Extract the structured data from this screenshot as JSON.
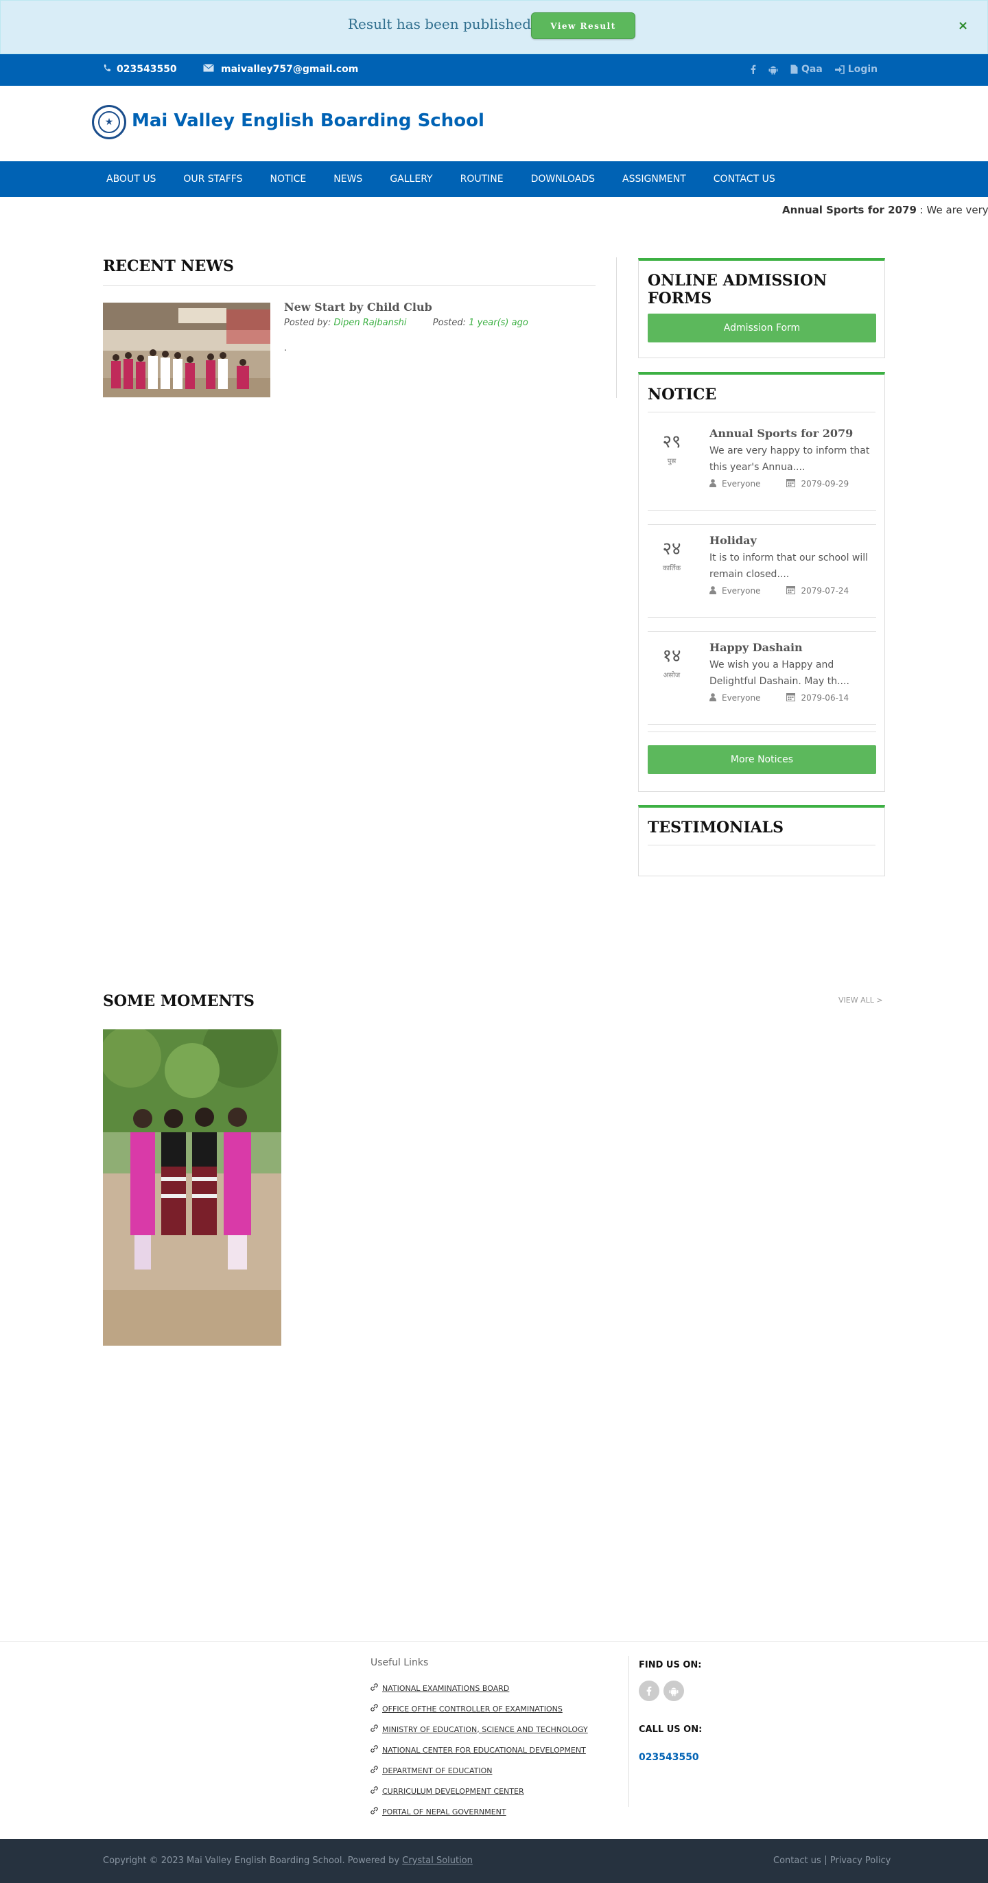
{
  "alert": {
    "text": "Result has been published.",
    "button": "View Result",
    "close": "×"
  },
  "topbar": {
    "phone": "023543550",
    "email": "maivalley757@gmail.com",
    "qaa": "Qaa",
    "login": "Login"
  },
  "header": {
    "site_title": "Mai Valley English Boarding School"
  },
  "nav": [
    "ABOUT US",
    "OUR STAFFS",
    "NOTICE",
    "NEWS",
    "GALLERY",
    "ROUTINE",
    "DOWNLOADS",
    "ASSIGNMENT",
    "CONTACT US"
  ],
  "ticker": {
    "bold": "Annual Sports for 2079",
    "text": " : We are very hap"
  },
  "recent_news": {
    "title": "RECENT NEWS",
    "item": {
      "headline": "New Start by Child Club",
      "posted_by_label": "Posted by: ",
      "author": "Dipen Rajbanshi",
      "posted_label": "Posted: ",
      "when": "1 year(s) ago",
      "excerpt": "."
    }
  },
  "admission": {
    "title": "ONLINE ADMISSION FORMS",
    "button": "Admission Form"
  },
  "notice": {
    "title": "NOTICE",
    "items": [
      {
        "day": "२९",
        "month": "पुस",
        "title": "Annual Sports for 2079",
        "desc": "We are very happy to inform that this year's Annua....",
        "audience": "Everyone",
        "date": "2079-09-29"
      },
      {
        "day": "२४",
        "month": "कार्तिक",
        "title": "Holiday",
        "desc": "It is to inform that our school will remain closed....",
        "audience": "Everyone",
        "date": "2079-07-24"
      },
      {
        "day": "१४",
        "month": "असोज",
        "title": "Happy Dashain",
        "desc": "We wish you a Happy and Delightful Dashain. May th....",
        "audience": "Everyone",
        "date": "2079-06-14"
      }
    ],
    "more_button": "More Notices"
  },
  "testimonials": {
    "title": "TESTIMONIALS"
  },
  "moments": {
    "title": "SOME MOMENTS",
    "view_all": "VIEW ALL >"
  },
  "footer": {
    "useful_links_title": "Useful Links",
    "links": [
      "NATIONAL EXAMINATIONS BOARD",
      "OFFICE OFTHE CONTROLLER OF EXAMINATIONS",
      "MINISTRY OF EDUCATION, SCIENCE AND TECHNOLOGY",
      "NATIONAL CENTER FOR EDUCATIONAL DEVELOPMENT",
      "DEPARTMENT OF EDUCATION",
      "CURRICULUM DEVELOPMENT CENTER",
      "PORTAL OF NEPAL GOVERNMENT"
    ],
    "find_us": "FIND US ON:",
    "call_us": "CALL US ON:",
    "call_number": "023543550"
  },
  "bottombar": {
    "copyright": "Copyright © 2023 Mai Valley English Boarding School. Powered by ",
    "powered_by": "Crystal Solution",
    "contact": "Contact us",
    "privacy": "Privacy Policy"
  },
  "colors": {
    "primary_blue": "#0062b4",
    "green": "#5cb85c",
    "accent_green": "#3cb043",
    "footer_dark": "#26323f"
  }
}
